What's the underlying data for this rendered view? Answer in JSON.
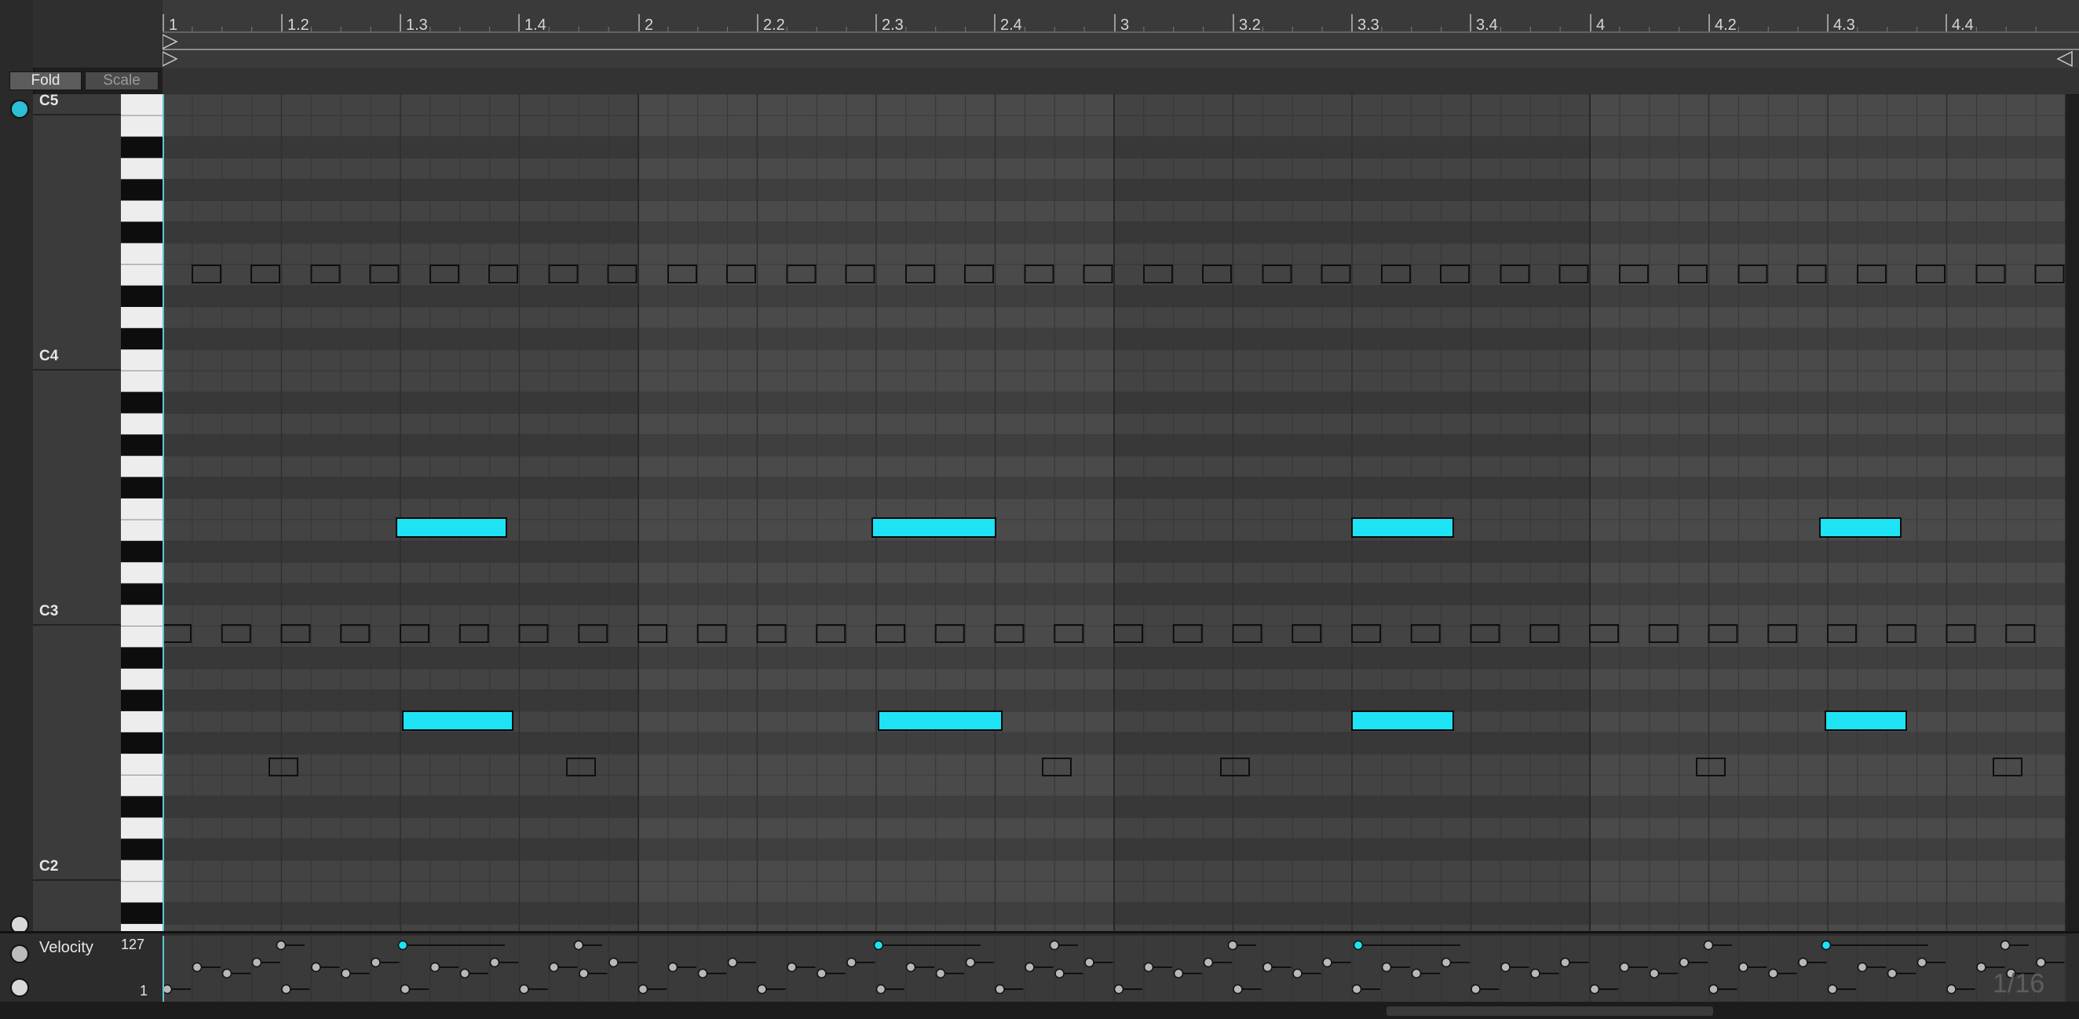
{
  "buttons": {
    "fold": "Fold",
    "scale": "Scale"
  },
  "ruler": {
    "labels": [
      "1",
      "1.2",
      "1.3",
      "1.4",
      "2",
      "2.2",
      "2.3",
      "2.4",
      "3",
      "3.2",
      "3.3",
      "3.4",
      "4",
      "4.2",
      "4.3",
      "4.4"
    ]
  },
  "pitch_labels": {
    "c5": "C5",
    "c4": "C4",
    "c3": "C3",
    "c2": "C2"
  },
  "velocity": {
    "title": "Velocity",
    "max": "127",
    "min": "1"
  },
  "grid_label": "1/16",
  "colors": {
    "note_selected": "#1ee3f5",
    "note_outline": "#101010",
    "grid_bg": "#3f3f3f"
  },
  "icons": {
    "lane_toggle": "headphone-preview-icon",
    "collapse": "minus-circle-icon",
    "lane_chooser": "arrow-circle-icon",
    "expand": "play-circle-icon"
  }
}
